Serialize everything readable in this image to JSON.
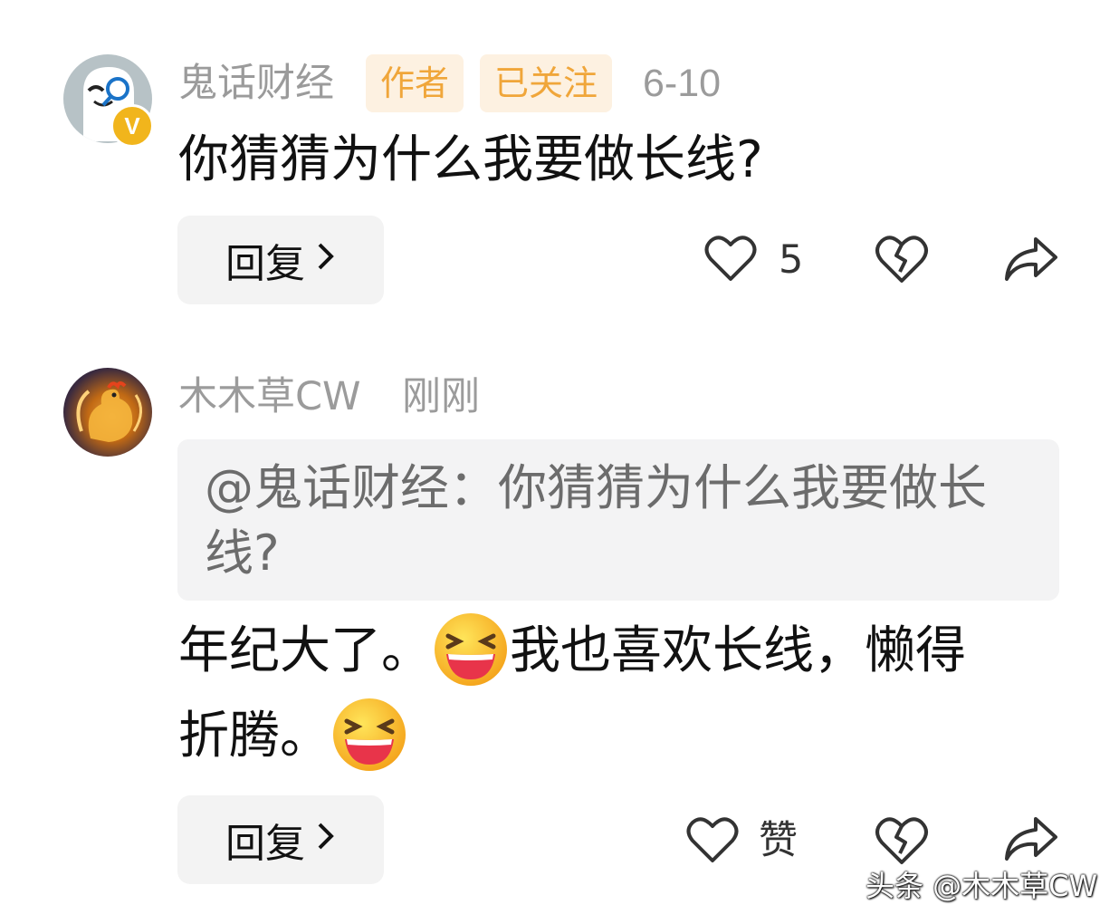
{
  "comment1": {
    "username": "鬼话财经",
    "tag_author": "作者",
    "tag_follow": "已关注",
    "date": "6-10",
    "text": "你猜猜为什么我要做长线?",
    "verified_badge": "V",
    "reply_label": "回复",
    "like_count": "5"
  },
  "comment2": {
    "username": "木木草CW",
    "time": "刚刚",
    "quote": "@鬼话财经：你猜猜为什么我要做长线?",
    "text_line1_a": "年纪大了。",
    "text_line1_b": "我也喜欢长线，懒得",
    "text_line2": "折腾。",
    "reply_label": "回复",
    "like_label": "赞"
  },
  "watermark": "头条 @木木草CW",
  "icons": [
    "ghost-avatar",
    "verified-badge-icon",
    "rooster-avatar",
    "heart-icon",
    "broken-heart-icon",
    "share-icon",
    "laughing-emoji-icon",
    "chevron-right-icon"
  ],
  "colors": {
    "tag_bg": "#fdf1e1",
    "tag_text": "#f0a63a",
    "badge": "#f1b51c",
    "muted_text": "#9b9b9b"
  }
}
